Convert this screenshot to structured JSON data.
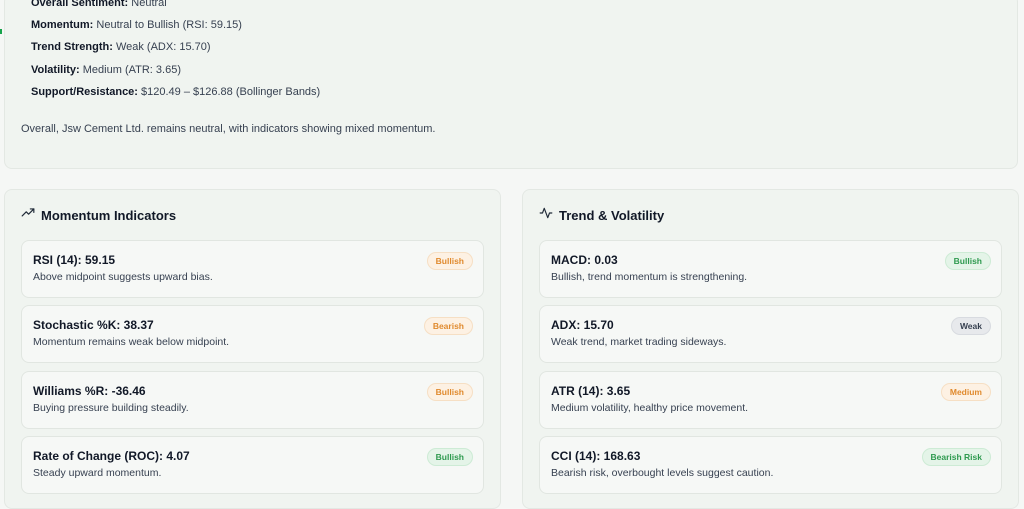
{
  "summary": {
    "rows": [
      {
        "label": "Overall Sentiment:",
        "value": "Neutral"
      },
      {
        "label": "Momentum:",
        "value": "Neutral to Bullish (RSI: 59.15)"
      },
      {
        "label": "Trend Strength:",
        "value": "Weak (ADX: 15.70)"
      },
      {
        "label": "Volatility:",
        "value": "Medium (ATR: 3.65)"
      },
      {
        "label": "Support/Resistance:",
        "value": "$120.49 – $126.88 (Bollinger Bands)"
      }
    ],
    "text": "Overall, Jsw Cement Ltd. remains neutral, with indicators showing mixed momentum."
  },
  "momentum": {
    "title": "Momentum Indicators",
    "icon": "trending-up-icon",
    "items": [
      {
        "title": "RSI (14): 59.15",
        "desc": "Above midpoint suggests upward bias.",
        "badge": "Bullish"
      },
      {
        "title": "Stochastic %K: 38.37",
        "desc": "Momentum remains weak below midpoint.",
        "badge": "Bearish"
      },
      {
        "title": "Williams %R: -36.46",
        "desc": "Buying pressure building steadily.",
        "badge": "Bullish"
      },
      {
        "title": "Rate of Change (ROC): 4.07",
        "desc": "Steady upward momentum.",
        "badge": "Bullish"
      }
    ]
  },
  "trend": {
    "title": "Trend & Volatility",
    "icon": "activity-icon",
    "items": [
      {
        "title": "MACD: 0.03",
        "desc": "Bullish, trend momentum is strengthening.",
        "badge": "Bullish"
      },
      {
        "title": "ADX: 15.70",
        "desc": "Weak trend, market trading sideways.",
        "badge": "Weak"
      },
      {
        "title": "ATR (14): 3.65",
        "desc": "Medium volatility, healthy price movement.",
        "badge": "Medium"
      },
      {
        "title": "CCI (14): 168.63",
        "desc": "Bearish risk, overbought levels suggest caution.",
        "badge": "Bearish Risk"
      }
    ]
  },
  "colors": {
    "orange_badge": "#e08a2e",
    "green_badge": "#2e9a4f",
    "gray_badge": "#374151"
  }
}
